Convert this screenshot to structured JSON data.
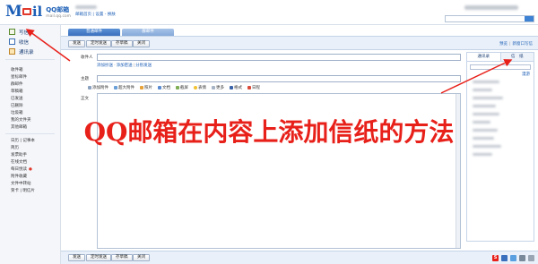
{
  "header": {
    "logo_text": "Mail",
    "logo_brand": "QQ邮箱",
    "logo_domain": "mail.qq.com",
    "links": "邮箱首页 | 设置 - 换肤"
  },
  "sidebar": {
    "actions": [
      {
        "label": "写信",
        "icon": "compose-icon"
      },
      {
        "label": "收信",
        "icon": "inbox-icon"
      },
      {
        "label": "通讯录",
        "icon": "contacts-icon"
      }
    ],
    "folders": [
      "收件箱",
      "星标邮件",
      "群邮件",
      "草稿箱",
      "已发送",
      "已删除",
      "垃圾箱"
    ],
    "extra": [
      "我的文件夹",
      "其他邮箱"
    ],
    "apps": [
      "日历 | 记事本",
      "简历",
      "发票助手",
      "在线文档",
      "每日悦读",
      "附件收藏",
      "文件中转站",
      "贺卡 | 明信片"
    ]
  },
  "tabs": [
    "普通邮件",
    "群邮件"
  ],
  "toolbar": {
    "send": "发送",
    "timed_send": "定时发送",
    "save_draft": "存草稿",
    "close": "关闭",
    "right_link_1": "预览",
    "right_link_2": "新窗口写信"
  },
  "form": {
    "to_label": "收件人",
    "cc_links": [
      "添加抄送",
      "添加密送",
      "分别发送"
    ],
    "subject_label": "主题",
    "body_label": "正文"
  },
  "format_bar": [
    "添加附件",
    "超大附件",
    "照片",
    "文档",
    "截屏",
    "表情",
    "更多",
    "格式",
    "日程"
  ],
  "right_panel": {
    "tab_contacts": "通讯录",
    "tab_stationery": "信　纸",
    "link": "漫游"
  },
  "overlay": {
    "title": "QQ邮箱在内容上添加信纸的方法"
  },
  "colors": {
    "accent": "#3a6fbd",
    "overlay_red": "#e8201a"
  }
}
